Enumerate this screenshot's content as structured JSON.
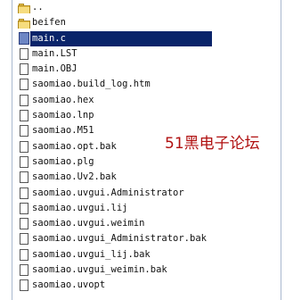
{
  "files": [
    {
      "name": "..",
      "icon": "folder-icon"
    },
    {
      "name": "beifen",
      "icon": "folder-icon"
    },
    {
      "name": "main.c",
      "icon": "c-source-icon",
      "selected": true
    },
    {
      "name": "main.LST",
      "icon": "file-icon"
    },
    {
      "name": "main.OBJ",
      "icon": "file-icon"
    },
    {
      "name": "saomiao.build_log.htm",
      "icon": "file-icon"
    },
    {
      "name": "saomiao.hex",
      "icon": "file-icon"
    },
    {
      "name": "saomiao.lnp",
      "icon": "file-icon"
    },
    {
      "name": "saomiao.M51",
      "icon": "file-icon"
    },
    {
      "name": "saomiao.opt.bak",
      "icon": "file-icon"
    },
    {
      "name": "saomiao.plg",
      "icon": "file-icon"
    },
    {
      "name": "saomiao.Uv2.bak",
      "icon": "file-icon"
    },
    {
      "name": "saomiao.uvgui.Administrator",
      "icon": "file-icon"
    },
    {
      "name": "saomiao.uvgui.lij",
      "icon": "file-icon"
    },
    {
      "name": "saomiao.uvgui.weimin",
      "icon": "file-icon"
    },
    {
      "name": "saomiao.uvgui_Administrator.bak",
      "icon": "file-icon"
    },
    {
      "name": "saomiao.uvgui_lij.bak",
      "icon": "file-icon"
    },
    {
      "name": "saomiao.uvgui_weimin.bak",
      "icon": "file-icon"
    },
    {
      "name": "saomiao.uvopt",
      "icon": "file-icon"
    }
  ],
  "watermark": {
    "text": "51黑电子论坛"
  },
  "colors": {
    "selection": "#0a246a",
    "folder": "#e8c24a",
    "watermark": "#b01010"
  }
}
